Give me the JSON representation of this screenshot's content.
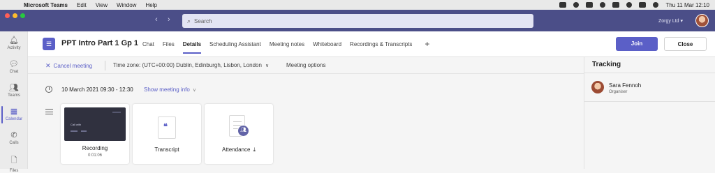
{
  "menubar": {
    "apple_glyph": "",
    "app_name": "Microsoft Teams",
    "menus": [
      "Edit",
      "View",
      "Window",
      "Help"
    ],
    "datetime": "Thu 11 Mar  12:10"
  },
  "titlebar": {
    "search_placeholder": "Search",
    "org_name": "Zorgy Ltd"
  },
  "rail": {
    "items": [
      {
        "label": "Activity",
        "icon": "bell-icon"
      },
      {
        "label": "Chat",
        "icon": "chat-icon"
      },
      {
        "label": "Teams",
        "icon": "teams-icon"
      },
      {
        "label": "Calendar",
        "icon": "calendar-icon"
      },
      {
        "label": "Calls",
        "icon": "phone-icon"
      },
      {
        "label": "Files",
        "icon": "file-icon"
      }
    ],
    "active": "Calendar"
  },
  "header": {
    "title": "PPT Intro Part 1 Gp 1",
    "tabs": [
      "Chat",
      "Files",
      "Details",
      "Scheduling Assistant",
      "Meeting notes",
      "Whiteboard",
      "Recordings & Transcripts"
    ],
    "active_tab": "Details",
    "join_label": "Join",
    "close_label": "Close"
  },
  "toolbar": {
    "cancel_label": "Cancel meeting",
    "timezone_label": "Time zone: (UTC+00:00) Dublin, Edinburgh, Lisbon, London",
    "options_label": "Meeting options"
  },
  "details": {
    "datetime": "10 March 2021 09:30 - 12:30",
    "show_info_label": "Show meeting info"
  },
  "cards": [
    {
      "label": "Recording",
      "sub": "0:01:06",
      "thumb_title": "Call with"
    },
    {
      "label": "Transcript"
    },
    {
      "label": "Attendance"
    }
  ],
  "tracking": {
    "title": "Tracking",
    "organizer_name": "Sara Fennoh",
    "organizer_role": "Organiser"
  },
  "colors": {
    "accent": "#5b5fc7",
    "titlebar": "#4b4e88"
  }
}
